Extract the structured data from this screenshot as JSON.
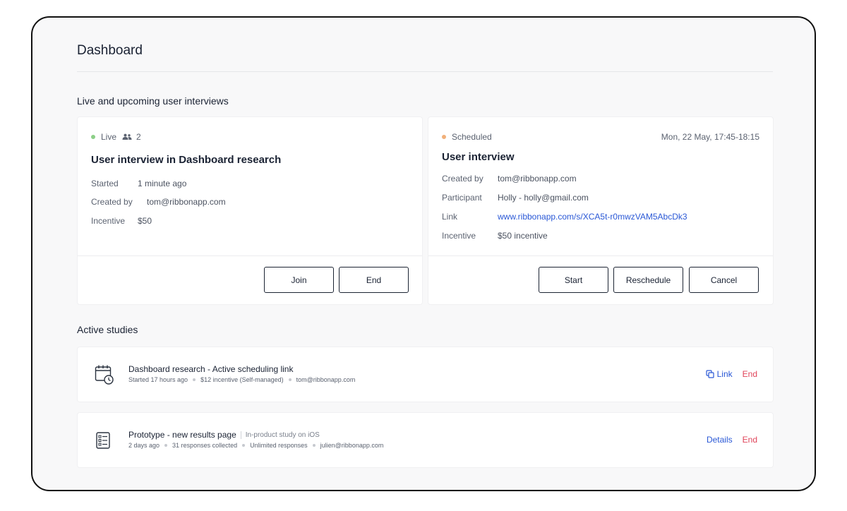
{
  "page": {
    "title": "Dashboard"
  },
  "sections": {
    "interviews": "Live and upcoming user interviews",
    "studies": "Active studies"
  },
  "live_card": {
    "status": "Live",
    "status_color": "#8ccf87",
    "participants": "2",
    "title": "User interview in Dashboard research",
    "rows": [
      {
        "key": "Started",
        "value": "1 minute ago"
      },
      {
        "key": "Created by",
        "value": "tom@ribbonapp.com"
      },
      {
        "key": "Incentive",
        "value": "$50"
      }
    ],
    "buttons": {
      "join": "Join",
      "end": "End"
    }
  },
  "scheduled_card": {
    "status": "Scheduled",
    "status_color": "#f1b07a",
    "datetime": "Mon, 22 May, 17:45-18:15",
    "title": "User interview",
    "rows": [
      {
        "key": "Created by",
        "value": "tom@ribbonapp.com"
      },
      {
        "key": "Participant",
        "value": "Holly - holly@gmail.com"
      },
      {
        "key": "Link",
        "value": "www.ribbonapp.com/s/XCA5t-r0mwzVAM5AbcDk3"
      },
      {
        "key": "Incentive",
        "value": "$50 incentive"
      }
    ],
    "buttons": {
      "start": "Start",
      "reschedule": "Reschedule",
      "cancel": "Cancel"
    }
  },
  "studies": [
    {
      "icon": "calendar-clock-icon",
      "name": "Dashboard research - Active scheduling link",
      "type": "",
      "meta": [
        "Started 17 hours ago",
        "$12 incentive (Self-managed)",
        "tom@ribbonapp.com"
      ],
      "primary_action": "Link",
      "end_action": "End"
    },
    {
      "icon": "form-list-icon",
      "name": "Prototype - new results page",
      "type": "In-product study on iOS",
      "meta": [
        "2 days ago",
        "31 responses collected",
        "Unlimited responses",
        "julien@ribbonapp.com"
      ],
      "primary_action": "Details",
      "end_action": "End"
    }
  ],
  "colors": {
    "link": "#2a58d6",
    "danger": "#e0445a"
  }
}
